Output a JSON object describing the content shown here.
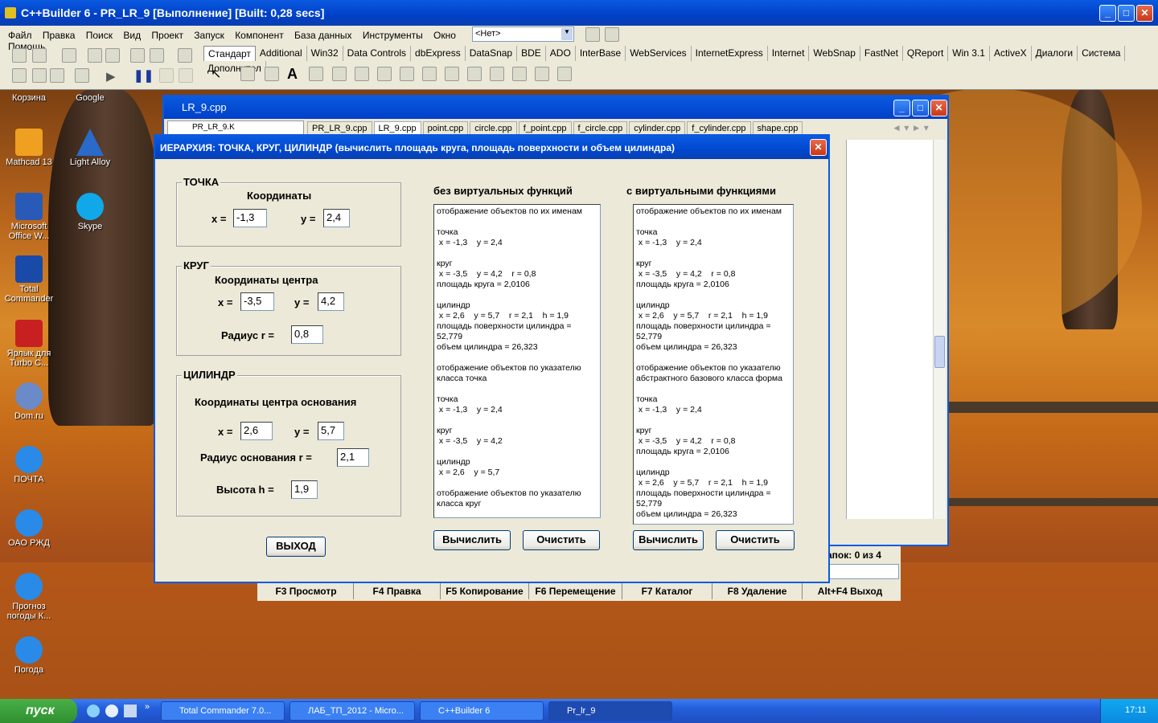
{
  "ide": {
    "title": "C++Builder 6 - PR_LR_9 [Выполнение] [Built: 0,28 secs]",
    "menu": [
      "Файл",
      "Правка",
      "Поиск",
      "Вид",
      "Проект",
      "Запуск",
      "Компонент",
      "База данных",
      "Инструменты",
      "Окно",
      "Помощь"
    ],
    "combo_value": "<Нет>",
    "palette_tabs": [
      "Стандарт",
      "Additional",
      "Win32",
      "Data Controls",
      "dbExpress",
      "DataSnap",
      "BDE",
      "ADO",
      "InterBase",
      "WebServices",
      "InternetExpress",
      "Internet",
      "WebSnap",
      "FastNet",
      "QReport",
      "Win 3.1",
      "ActiveX",
      "Диалоги",
      "Система",
      "Дополнител"
    ]
  },
  "desktop_icons": [
    {
      "label": "Корзина",
      "icon": "recycle-bin-icon"
    },
    {
      "label": "Google",
      "icon": "google-icon"
    },
    {
      "label": "Mathcad 13",
      "icon": "mathcad-icon"
    },
    {
      "label": "Light Alloy",
      "icon": "light-alloy-icon"
    },
    {
      "label": "Microsoft Office W...",
      "icon": "word-icon"
    },
    {
      "label": "Skype",
      "icon": "skype-icon"
    },
    {
      "label": "Total Commander",
      "icon": "total-commander-icon"
    },
    {
      "label": "Ярлык для Turbo C...",
      "icon": "turbo-c-icon"
    },
    {
      "label": "Dom.ru",
      "icon": "dom-ru-icon"
    },
    {
      "label": "ПОЧТА",
      "icon": "ie-icon"
    },
    {
      "label": "ОАО РЖД",
      "icon": "ie-icon"
    },
    {
      "label": "Прогноз погоды К...",
      "icon": "ie-icon"
    },
    {
      "label": "Погода",
      "icon": "ie-icon"
    }
  ],
  "editor": {
    "title": "LR_9.cpp",
    "tree_item": "PR_LR_9.K",
    "tabs": [
      "PR_LR_9.cpp",
      "LR_9.cpp",
      "point.cpp",
      "circle.cpp",
      "f_point.cpp",
      "f_circle.cpp",
      "cylinder.cpp",
      "f_cylinder.cpp",
      "shape.cpp"
    ]
  },
  "dialog": {
    "title": "ИЕРАРХИЯ: ТОЧКА, КРУГ, ЦИЛИНДР (вычислить площадь круга, площадь поверхности и объем цилиндра)",
    "point": {
      "caption": "ТОЧКА",
      "sub": "Координаты",
      "x_label": "x =",
      "y_label": "y =",
      "x": "-1,3",
      "y": "2,4"
    },
    "circle": {
      "caption": "КРУГ",
      "sub": "Координаты центра",
      "x_label": "x =",
      "y_label": "y =",
      "x": "-3,5",
      "y": "4,2",
      "r_label": "Радиус  r =",
      "r": "0,8"
    },
    "cylinder": {
      "caption": "ЦИЛИНДР",
      "sub": "Координаты центра основания",
      "x_label": "x =",
      "y_label": "y =",
      "x": "2,6",
      "y": "5,7",
      "r_label": "Радиус основания   r =",
      "r": "2,1",
      "h_label": "Высота   h =",
      "h": "1,9"
    },
    "exit_label": "ВЫХОД",
    "left_head": "без виртуальных функций",
    "right_head": "с виртуальными функциями",
    "left_memo": "отображение объектов по их именам\n\nточка\n x = -1,3    y = 2,4\n\nкруг\n x = -3,5    y = 4,2    r = 0,8\nплощадь круга = 2,0106\n\nцилиндр\n x = 2,6    y = 5,7    r = 2,1    h = 1,9\nплощадь поверхности цилиндра =\n52,779\nобъем цилиндра = 26,323\n\nотображение объектов по указателю\nкласса точка\n\nточка\n x = -1,3    y = 2,4\n\nкруг\n x = -3,5    y = 4,2\n\nцилиндр\n x = 2,6    y = 5,7\n\nотображение объектов по указателю\nкласса круг",
    "right_memo": "отображение объектов по их именам\n\nточка\n x = -1,3    y = 2,4\n\nкруг\n x = -3,5    y = 4,2    r = 0,8\nплощадь круга = 2,0106\n\nцилиндр\n x = 2,6    y = 5,7    r = 2,1    h = 1,9\nплощадь поверхности цилиндра =\n52,779\nобъем цилиндра = 26,323\n\nотображение объектов по указателю\nабстрактного базового класса форма\n\nточка\n x = -1,3    y = 2,4\n\nкруг\n x = -3,5    y = 4,2    r = 0,8\nплощадь круга = 2,0106\n\nцилиндр\n x = 2,6    y = 5,7    r = 2,1    h = 1,9\nплощадь поверхности цилиндра =\n52,779\nобъем цилиндра = 26,323",
    "calc_label": "Вычислить",
    "clear_label": "Очистить"
  },
  "tc": {
    "status": "апок: 0 из 4",
    "fkeys": [
      "F3 Просмотр",
      "F4 Правка",
      "F5 Копирование",
      "F6 Перемещение",
      "F7 Каталог",
      "F8 Удаление",
      "Alt+F4 Выход"
    ]
  },
  "taskbar": {
    "start": "пуск",
    "tasks": [
      "Total Commander 7.0...",
      "ЛАБ_ТП_2012 - Micro...",
      "C++Builder 6",
      "Pr_lr_9"
    ],
    "clock": "17:11"
  }
}
